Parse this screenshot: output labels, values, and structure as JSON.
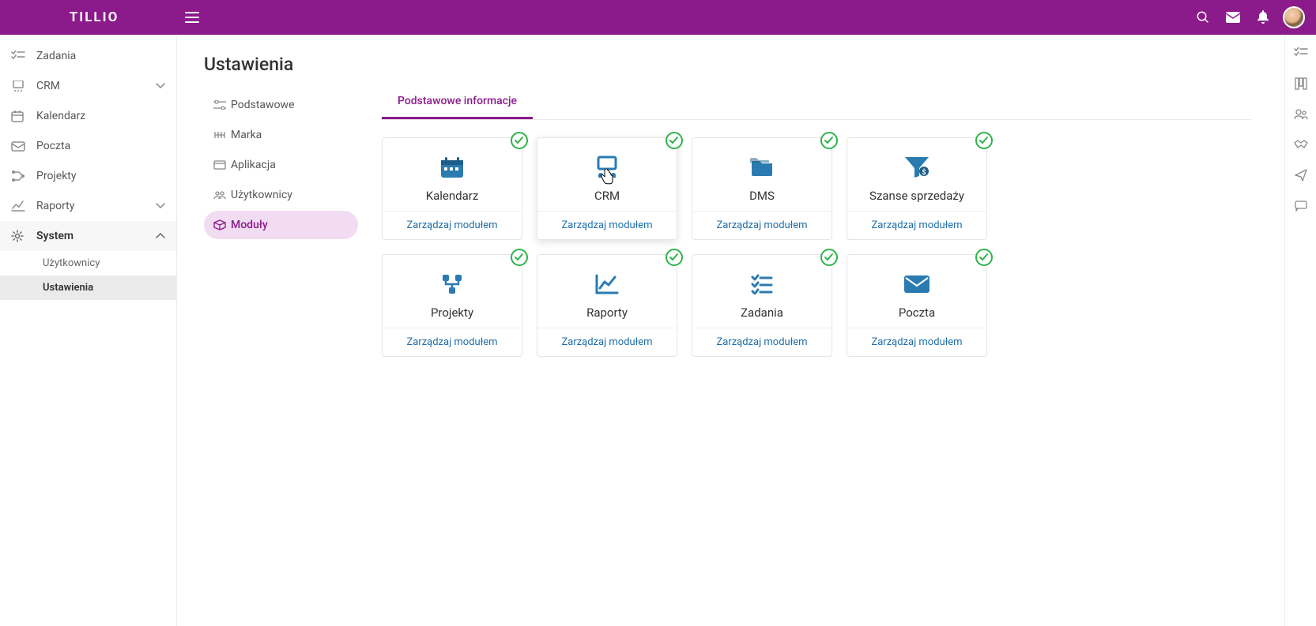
{
  "brand": "TILLIO",
  "sidebar": {
    "items": [
      {
        "label": "Zadania",
        "icon": "tasks"
      },
      {
        "label": "CRM",
        "icon": "crm",
        "chevron": "down"
      },
      {
        "label": "Kalendarz",
        "icon": "calendar"
      },
      {
        "label": "Poczta",
        "icon": "mail"
      },
      {
        "label": "Projekty",
        "icon": "projects"
      },
      {
        "label": "Raporty",
        "icon": "reports",
        "chevron": "down"
      },
      {
        "label": "System",
        "icon": "gear",
        "chevron": "up",
        "expanded": true
      }
    ],
    "subitems": [
      {
        "label": "Użytkownicy"
      },
      {
        "label": "Ustawienia",
        "active": true
      }
    ]
  },
  "page": {
    "title": "Ustawienia"
  },
  "subnav": [
    {
      "label": "Podstawowe",
      "icon": "sliders"
    },
    {
      "label": "Marka",
      "icon": "brand"
    },
    {
      "label": "Aplikacja",
      "icon": "app"
    },
    {
      "label": "Użytkownicy",
      "icon": "users"
    },
    {
      "label": "Moduły",
      "icon": "package",
      "active": true
    }
  ],
  "tab": {
    "label": "Podstawowe informacje"
  },
  "card_action": "Zarządzaj modułem",
  "modules": [
    {
      "name": "Kalendarz",
      "icon": "calendar"
    },
    {
      "name": "CRM",
      "icon": "crm",
      "hover": true
    },
    {
      "name": "DMS",
      "icon": "folders"
    },
    {
      "name": "Szanse sprzedaży",
      "icon": "funnel"
    },
    {
      "name": "Projekty",
      "icon": "nodes"
    },
    {
      "name": "Raporty",
      "icon": "chart"
    },
    {
      "name": "Zadania",
      "icon": "checklist"
    },
    {
      "name": "Poczta",
      "icon": "envelope"
    }
  ]
}
